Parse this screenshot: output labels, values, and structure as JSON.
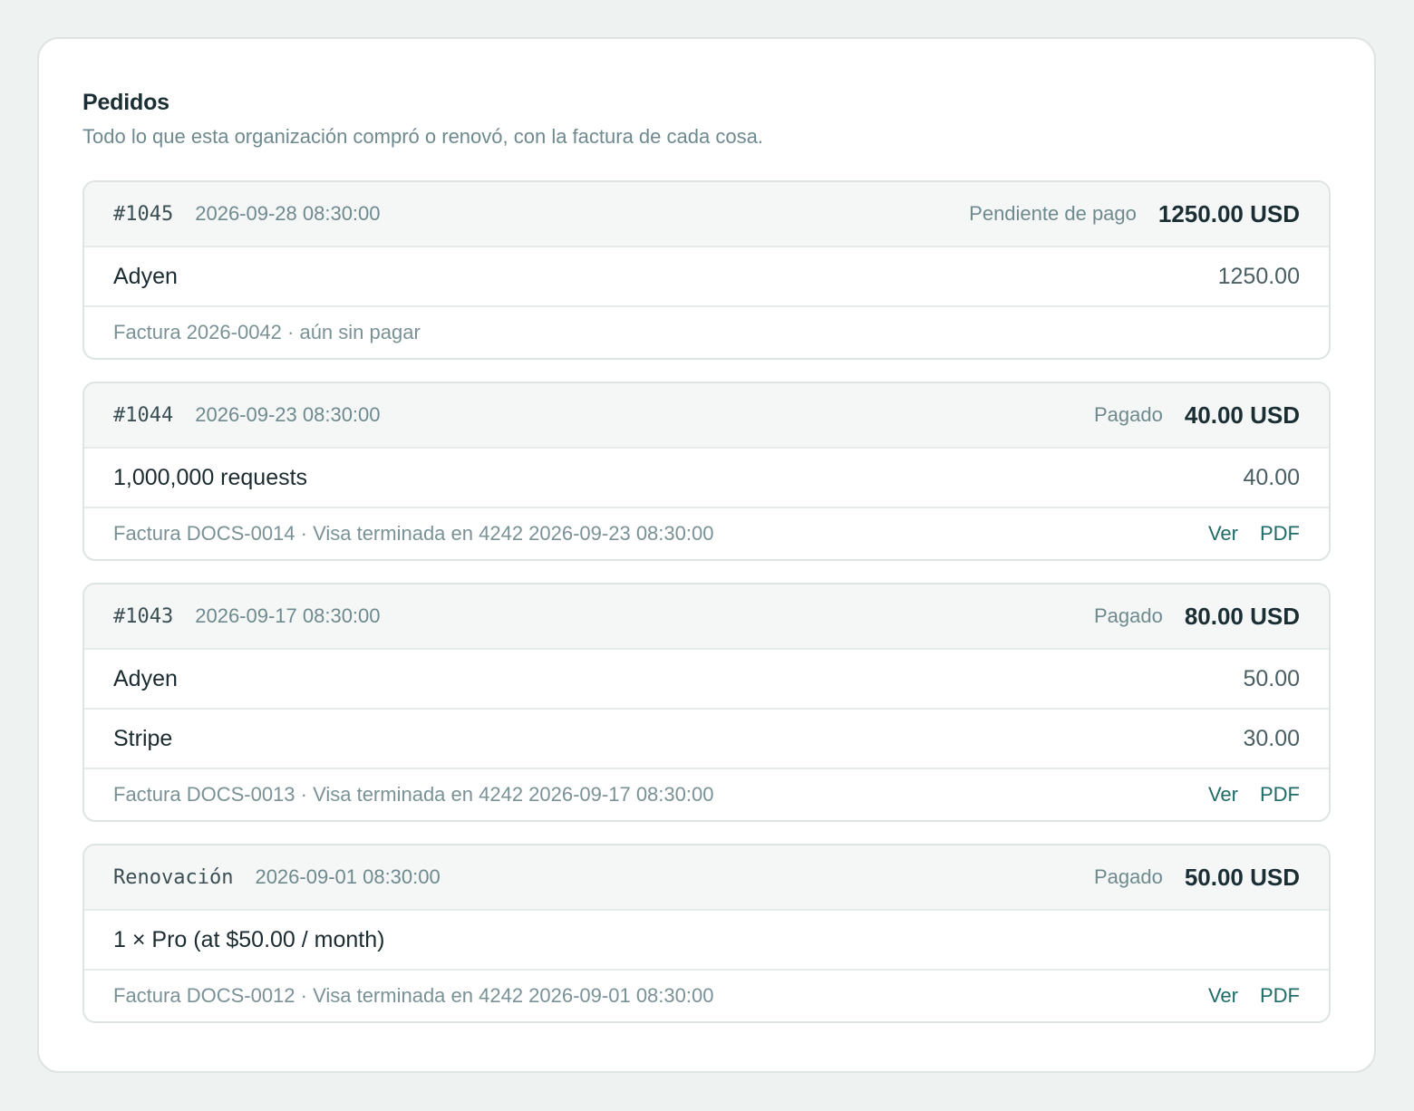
{
  "header": {
    "title": "Pedidos",
    "subtitle": "Todo lo que esta organización compró o renovó, con la factura de cada cosa."
  },
  "orders": [
    {
      "id": "#1045",
      "date": "2026-09-28 08:30:00",
      "status": "Pendiente de pago",
      "total": "1250.00 USD",
      "lines": [
        {
          "name": "Adyen",
          "amount": "1250.00"
        }
      ],
      "invoice": "Factura 2026-0042 · aún sin pagar",
      "links": []
    },
    {
      "id": "#1044",
      "date": "2026-09-23 08:30:00",
      "status": "Pagado",
      "total": "40.00 USD",
      "lines": [
        {
          "name": "1,000,000 requests",
          "amount": "40.00"
        }
      ],
      "invoice": "Factura DOCS-0014 · Visa terminada en 4242 2026-09-23 08:30:00",
      "links": [
        "Ver",
        "PDF"
      ]
    },
    {
      "id": "#1043",
      "date": "2026-09-17 08:30:00",
      "status": "Pagado",
      "total": "80.00 USD",
      "lines": [
        {
          "name": "Adyen",
          "amount": "50.00"
        },
        {
          "name": "Stripe",
          "amount": "30.00"
        }
      ],
      "invoice": "Factura DOCS-0013 · Visa terminada en 4242 2026-09-17 08:30:00",
      "links": [
        "Ver",
        "PDF"
      ]
    },
    {
      "id": "Renovación",
      "date": "2026-09-01 08:30:00",
      "status": "Pagado",
      "total": "50.00 USD",
      "lines": [
        {
          "name": "1 × Pro (at $50.00 / month)",
          "amount": ""
        }
      ],
      "invoice": "Factura DOCS-0012 · Visa terminada en 4242 2026-09-01 08:30:00",
      "links": [
        "Ver",
        "PDF"
      ]
    }
  ]
}
